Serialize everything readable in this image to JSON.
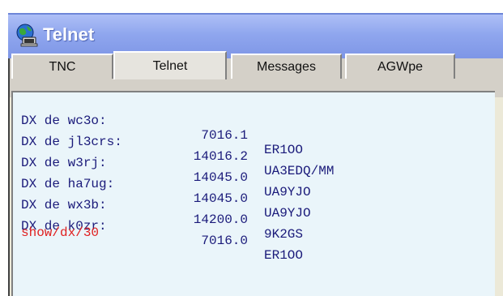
{
  "window": {
    "title": "Telnet",
    "app_icon": "globe-computer-icon"
  },
  "tabs": [
    {
      "label": "TNC",
      "active": false
    },
    {
      "label": "Telnet",
      "active": true
    },
    {
      "label": "Messages",
      "active": false
    },
    {
      "label": "AGWpe",
      "active": false
    }
  ],
  "terminal": {
    "spots": [
      {
        "prefix": "DX de wc3o:",
        "freq": "7016.1",
        "call": "ER1OO"
      },
      {
        "prefix": "DX de jl3crs:",
        "freq": "14016.2",
        "call": "UA3EDQ/MM"
      },
      {
        "prefix": "DX de w3rj:",
        "freq": "14045.0",
        "call": "UA9YJO"
      },
      {
        "prefix": "DX de ha7ug:",
        "freq": "14045.0",
        "call": "UA9YJO"
      },
      {
        "prefix": "DX de wx3b:",
        "freq": "14200.0",
        "call": "9K2GS"
      },
      {
        "prefix": "DX de k0zr:",
        "freq": "7016.0",
        "call": "ER1OO"
      }
    ],
    "command": "show/dx/30",
    "text_color": "#1a1a7a",
    "command_color": "#e02020"
  }
}
